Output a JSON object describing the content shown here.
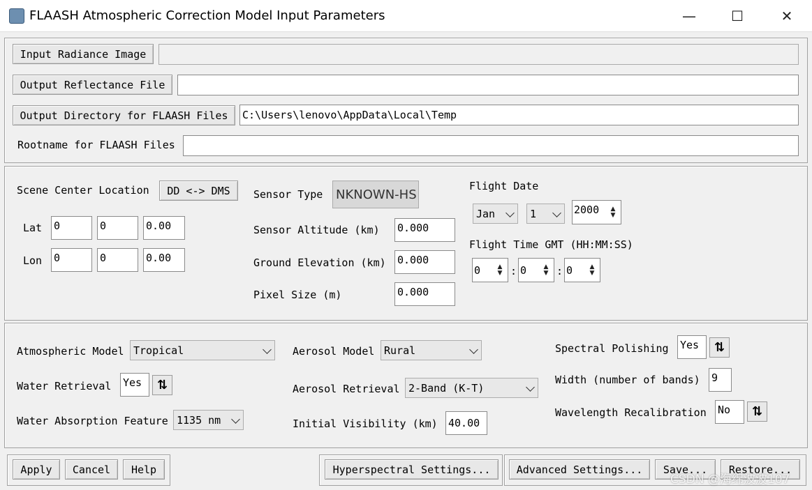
{
  "window": {
    "title": "FLAASH Atmospheric Correction Model Input Parameters",
    "minimize_glyph": "—",
    "maximize_glyph": "☐",
    "close_glyph": "✕"
  },
  "files": {
    "input_radiance_label": "Input Radiance Image",
    "input_radiance_value": "",
    "output_reflectance_label": "Output Reflectance File",
    "output_reflectance_value": "",
    "output_directory_label": "Output Directory for FLAASH Files",
    "output_directory_value": "C:\\Users\\lenovo\\AppData\\Local\\Temp",
    "rootname_label": "Rootname for FLAASH Files",
    "rootname_value": ""
  },
  "scene": {
    "center_label": "Scene Center Location",
    "dd_dms_button": "DD <-> DMS",
    "lat_label": "Lat",
    "lat_values": [
      "0",
      "0",
      "0.00"
    ],
    "lon_label": "Lon",
    "lon_values": [
      "0",
      "0",
      "0.00"
    ]
  },
  "sensor": {
    "type_label": "Sensor Type",
    "type_value": "NKNOWN-HS",
    "altitude_label": "Sensor Altitude (km)",
    "altitude_value": "0.000",
    "ground_label": "Ground Elevation (km)",
    "ground_value": "0.000",
    "pixel_label": "Pixel Size (m)",
    "pixel_value": "0.000"
  },
  "flight": {
    "date_label": "Flight Date",
    "month": "Jan",
    "day": "1",
    "year": "2000",
    "time_label": "Flight Time GMT (HH:MM:SS)",
    "hh": "0",
    "mm": "0",
    "ss": "0",
    "sep": ":"
  },
  "model": {
    "atmospheric_label": "Atmospheric Model",
    "atmospheric_value": "Tropical",
    "water_retrieval_label": "Water Retrieval",
    "water_retrieval_value": "Yes",
    "water_absorption_label": "Water Absorption Feature",
    "water_absorption_value": "1135 nm",
    "aerosol_model_label": "Aerosol Model",
    "aerosol_model_value": "Rural",
    "aerosol_retrieval_label": "Aerosol Retrieval",
    "aerosol_retrieval_value": "2-Band (K-T)",
    "visibility_label": "Initial Visibility (km)",
    "visibility_value": "40.00",
    "spectral_polishing_label": "Spectral Polishing",
    "spectral_polishing_value": "Yes",
    "width_label": "Width (number of bands)",
    "width_value": "9",
    "wavelength_label": "Wavelength Recalibration",
    "wavelength_value": "No",
    "toggle_glyph": "⇅"
  },
  "footer": {
    "apply": "Apply",
    "cancel": "Cancel",
    "help": "Help",
    "hyperspectral": "Hyperspectral Settings...",
    "advanced": "Advanced Settings...",
    "save": "Save...",
    "restore": "Restore..."
  },
  "watermark": "CSDN @海绵波波107"
}
